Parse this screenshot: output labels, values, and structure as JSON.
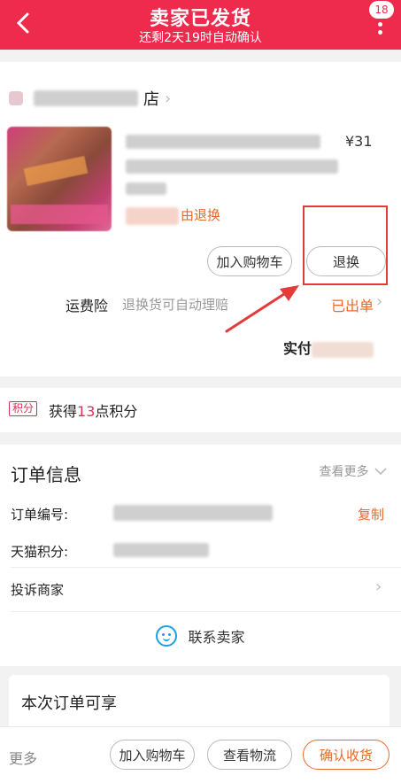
{
  "header": {
    "title": "卖家已发货",
    "subtitle": "还剩2天19时自动确认",
    "badge": "18"
  },
  "shop": {
    "name_tail": "店"
  },
  "item": {
    "price": "¥31",
    "tag_tail": "由退换"
  },
  "actions": {
    "add_to_cart": "加入购物车",
    "return_exchange": "退换"
  },
  "insurance": {
    "label": "运费险",
    "desc": "退换货可自动理赔",
    "status": "已出单"
  },
  "payment": {
    "label_prefix": "实付"
  },
  "points": {
    "tag": "积分",
    "prefix": "获得",
    "count": "13",
    "suffix": "点积分"
  },
  "order_info": {
    "title": "订单信息",
    "more": "查看更多",
    "order_no_label": "订单编号:",
    "copy": "复制",
    "tmall_points_label": "天猫积分:",
    "complain": "投诉商家"
  },
  "contact": {
    "label": "联系卖家"
  },
  "enjoy": {
    "title": "本次订单可享"
  },
  "bottom": {
    "more": "更多",
    "add_to_cart": "加入购物车",
    "logistics": "查看物流",
    "confirm": "确认收货"
  },
  "colors": {
    "header": "#ee2a4d",
    "accent_orange": "#e9692c",
    "highlight_red": "#e43a3a"
  }
}
